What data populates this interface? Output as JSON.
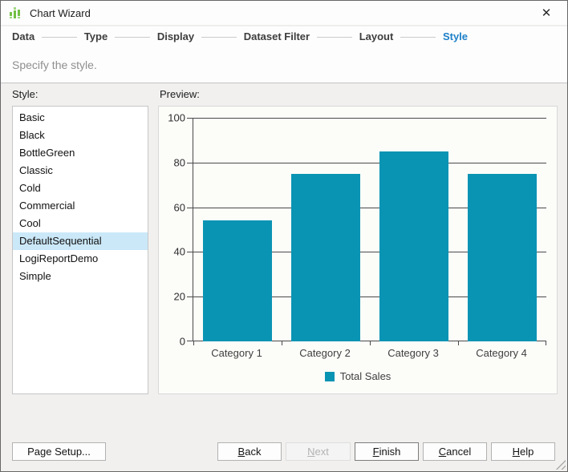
{
  "window": {
    "title": "Chart Wizard",
    "close_icon": "✕"
  },
  "steps": {
    "items": [
      {
        "label": "Data",
        "active": false
      },
      {
        "label": "Type",
        "active": false
      },
      {
        "label": "Display",
        "active": false
      },
      {
        "label": "Dataset Filter",
        "active": false
      },
      {
        "label": "Layout",
        "active": false
      },
      {
        "label": "Style",
        "active": true
      }
    ]
  },
  "subtitle": "Specify the style.",
  "style_panel": {
    "label": "Style:",
    "items": [
      "Basic",
      "Black",
      "BottleGreen",
      "Classic",
      "Cold",
      "Commercial",
      "Cool",
      "DefaultSequential",
      "LogiReportDemo",
      "Simple"
    ],
    "selected": "DefaultSequential"
  },
  "preview_panel": {
    "label": "Preview:"
  },
  "chart_data": {
    "type": "bar",
    "categories": [
      "Category 1",
      "Category 2",
      "Category 3",
      "Category 4"
    ],
    "series": [
      {
        "name": "Total Sales",
        "values": [
          54,
          75,
          85,
          75
        ],
        "color": "#0a94b4"
      }
    ],
    "title": "",
    "xlabel": "",
    "ylabel": "",
    "ylim": [
      0,
      100
    ],
    "yticks": [
      0,
      20,
      40,
      60,
      80,
      100
    ],
    "grid": true,
    "legend_position": "bottom"
  },
  "buttons": {
    "page_setup": "Page Setup...",
    "back": {
      "key": "B",
      "rest": "ack"
    },
    "next": {
      "key": "N",
      "rest": "ext"
    },
    "finish": {
      "key": "F",
      "rest": "inish"
    },
    "cancel": {
      "key": "C",
      "rest": "ancel"
    },
    "help": {
      "key": "H",
      "rest": "elp"
    }
  },
  "colors": {
    "accent_blue": "#1d80c8",
    "bar_teal": "#0a94b4",
    "selection_bg": "#cbe8f8",
    "app_icon_green": "#72bf44",
    "gridline": "#4a4a4a"
  }
}
